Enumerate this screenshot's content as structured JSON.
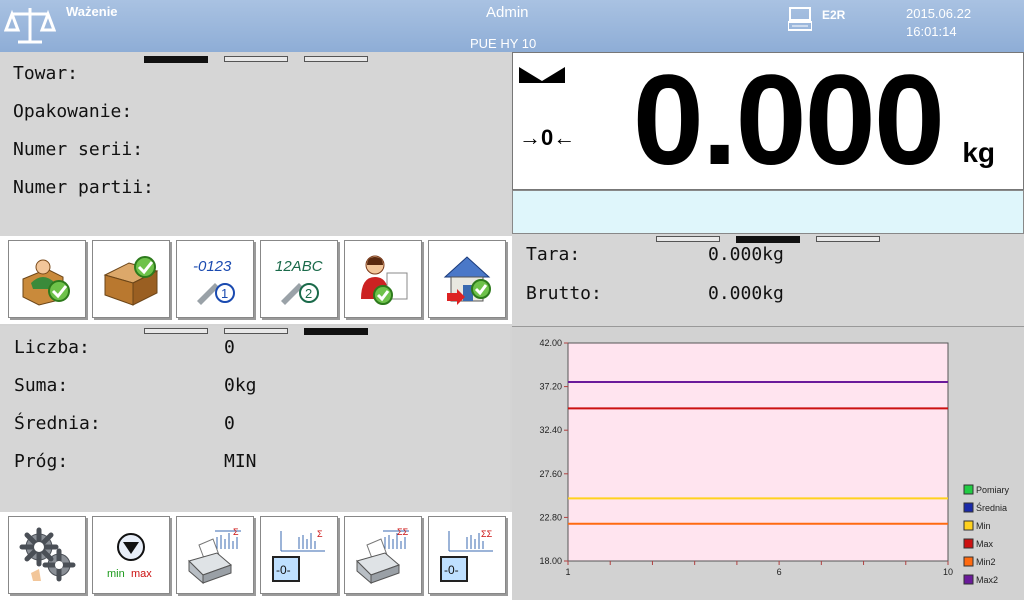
{
  "header": {
    "title": "Ważenie",
    "user": "Admin",
    "model": "PUE HY 10",
    "interface": "E2R",
    "date": "2015.06.22",
    "time": "16:01:14"
  },
  "info": {
    "product_label": "Towar:",
    "packaging_label": "Opakowanie:",
    "serial_label": "Numer serii:",
    "batch_label": "Numer partii:"
  },
  "display": {
    "weight": "0.000",
    "unit": "kg",
    "zero_marker": "→0←"
  },
  "tare": {
    "tare_label": "Tara:",
    "tare_value": "0.000kg",
    "gross_label": "Brutto:",
    "gross_value": "0.000kg"
  },
  "stats": {
    "count_label": "Liczba:",
    "count_value": "0",
    "sum_label": "Suma:",
    "sum_value": "0kg",
    "mean_label": "Średnia:",
    "mean_value": "0",
    "threshold_label": "Próg:",
    "threshold_value": "MIN"
  },
  "buttons_top": [
    "contractor-select-icon",
    "product-select-icon",
    "variable-1-icon",
    "variable-2-icon",
    "operator-select-icon",
    "warehouse-select-icon"
  ],
  "buttons_bottom": [
    "settings-icon",
    "min-max-threshold-icon",
    "print-statistics-icon",
    "zero-statistics-icon",
    "print-total-statistics-icon",
    "zero-total-statistics-icon"
  ],
  "btn_text": {
    "variable_1": "-0123",
    "variable_1_num": "1",
    "variable_2": "12ABC",
    "variable_2_num": "2",
    "minmax_min": "min",
    "minmax_max": "max",
    "zero": "-0-",
    "sigma": "Σ",
    "double_sigma": "ΣΣ"
  },
  "colors": {
    "header_bg": "#9db8de",
    "chart_bg": "#ffe4ef",
    "display_bar": "#dff6fb"
  },
  "chart_data": {
    "type": "line",
    "ylim": [
      18.0,
      42.0
    ],
    "xlim": [
      1,
      10
    ],
    "yticks": [
      "42.00",
      "37.20",
      "32.40",
      "27.60",
      "22.80",
      "18.00"
    ],
    "xticks": [
      "1",
      "6",
      "10"
    ],
    "series": [
      {
        "name": "Pomiary",
        "color": "#22cc44",
        "values": []
      },
      {
        "name": "Średnia",
        "color": "#1a2aa8",
        "values": []
      },
      {
        "name": "Min",
        "color": "#ffd21f",
        "values": [
          24.9,
          24.9
        ]
      },
      {
        "name": "Max",
        "color": "#cc1111",
        "values": [
          34.8,
          34.8
        ]
      },
      {
        "name": "Min2",
        "color": "#ff6a10",
        "values": [
          22.1,
          22.1
        ]
      },
      {
        "name": "Max2",
        "color": "#6a1a9a",
        "values": [
          37.7,
          37.7
        ]
      }
    ],
    "legend_position": "right"
  }
}
